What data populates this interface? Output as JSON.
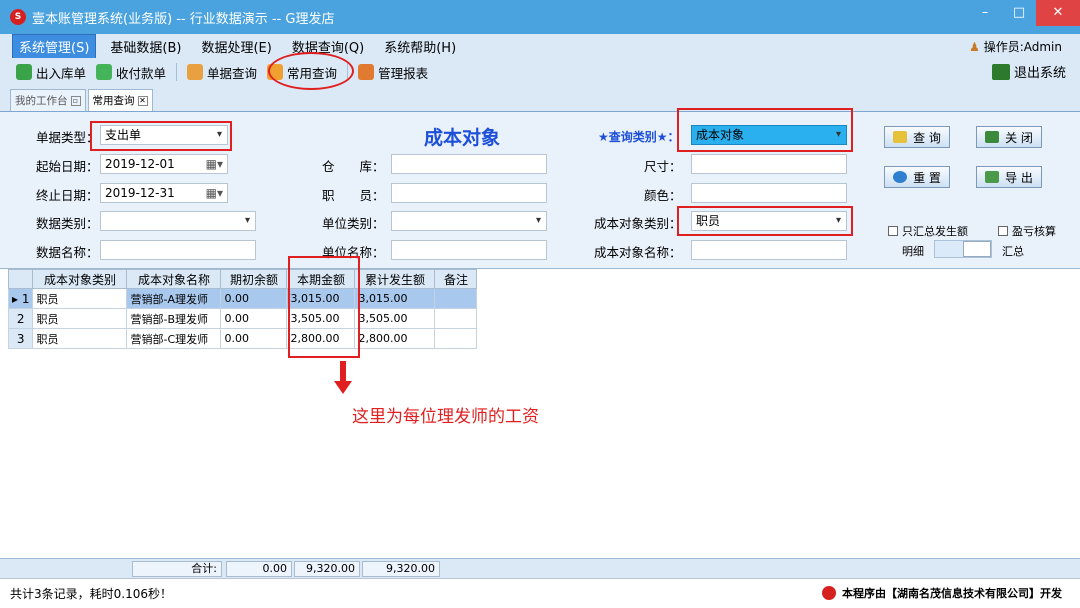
{
  "window": {
    "title": "壹本账管理系统(业务版) -- 行业数据演示 -- G理发店",
    "min": "–",
    "max": "□",
    "close": "✕"
  },
  "menu": {
    "items": [
      "系统管理(S)",
      "基础数据(B)",
      "数据处理(E)",
      "数据查询(Q)",
      "系统帮助(H)"
    ],
    "operator": "操作员:Admin"
  },
  "toolbar": {
    "items": [
      "出入库单",
      "收付款单",
      "单据查询",
      "常用查询",
      "管理报表"
    ],
    "exit": "退出系统"
  },
  "tabs": [
    {
      "label": "我的工作台"
    },
    {
      "label": "常用查询"
    }
  ],
  "form": {
    "heading": "成本对象",
    "bill_type_label": "单据类型：",
    "bill_type": "支出单",
    "start_date_label": "起始日期：",
    "start_date": "2019-12-01",
    "end_date_label": "终止日期：",
    "end_date": "2019-12-31",
    "data_type_label": "数据类别：",
    "data_type": "",
    "data_name_label": "数据名称：",
    "data_name": "",
    "warehouse_label": "仓　　库：",
    "warehouse": "",
    "staff_label": "职　　员：",
    "staff": "",
    "unit_type_label": "单位类别：",
    "unit_type": "",
    "unit_name_label": "单位名称：",
    "unit_name": "",
    "query_type_label": "★查询类别★：",
    "query_type": "成本对象",
    "size_label": "尺寸：",
    "size": "",
    "color_label": "颜色：",
    "color": "",
    "cost_obj_type_label": "成本对象类别：",
    "cost_obj_type": "职员",
    "cost_obj_name_label": "成本对象名称：",
    "cost_obj_name": "",
    "query_btn": "查 询",
    "close_btn": "关 闭",
    "reset_btn": "重 置",
    "export_btn": "导 出",
    "only_sum_label": "只汇总发生额",
    "pnl_label": "盈亏核算",
    "detail_label": "明细",
    "summary_label": "汇总"
  },
  "grid": {
    "headers": [
      "成本对象类别",
      "成本对象名称",
      "期初余额",
      "本期金额",
      "累计发生额",
      "备注"
    ],
    "rows": [
      {
        "num": "1",
        "type": "职员",
        "name": "营销部-A理发师",
        "opening": "0.00",
        "current": "3,015.00",
        "cumulative": "3,015.00",
        "note": ""
      },
      {
        "num": "2",
        "type": "职员",
        "name": "营销部-B理发师",
        "opening": "0.00",
        "current": "3,505.00",
        "cumulative": "3,505.00",
        "note": ""
      },
      {
        "num": "3",
        "type": "职员",
        "name": "营销部-C理发师",
        "opening": "0.00",
        "current": "2,800.00",
        "cumulative": "2,800.00",
        "note": ""
      }
    ],
    "annotation": "这里为每位理发师的工资"
  },
  "footer": {
    "total_label": "合计:",
    "opening": "0.00",
    "current": "9,320.00",
    "cumulative": "9,320.00"
  },
  "status": {
    "left": "共计3条记录，耗时0.106秒！",
    "right": "本程序由【湖南名茂信息技术有限公司】开发"
  },
  "colors": {
    "titlebar": "#4aa3df",
    "accent": "#1d4fd8",
    "highlight": "#e02020",
    "selection": "#a9c8ee"
  }
}
